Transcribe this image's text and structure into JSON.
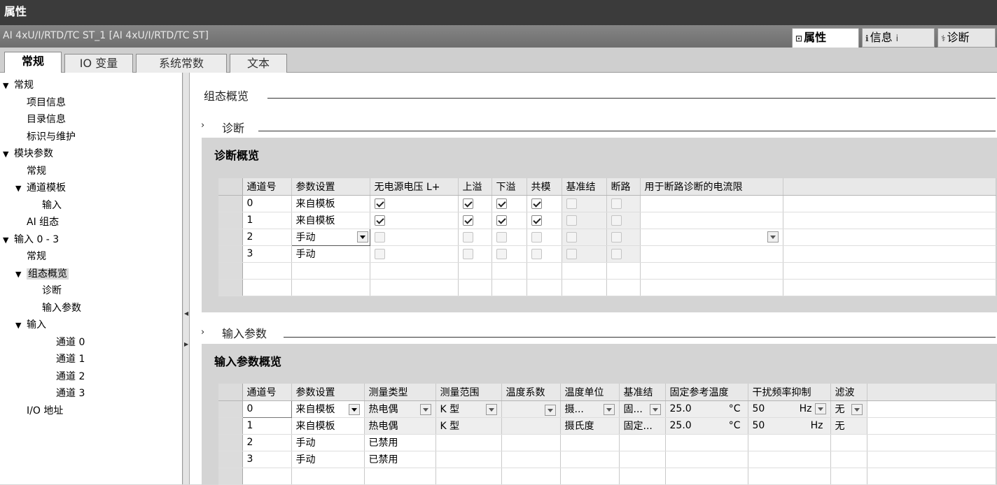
{
  "window": {
    "title": "属性"
  },
  "objectbar": {
    "text": "AI 4xU/I/RTD/TC ST_1 [AI 4xU/I/RTD/TC ST]"
  },
  "right_tabs": [
    {
      "label": "属性",
      "icon": "properties-icon"
    },
    {
      "label": "信息",
      "icon": "info-icon"
    },
    {
      "label": "诊断",
      "icon": "diagnostics-icon"
    }
  ],
  "tabs": [
    {
      "label": "常规"
    },
    {
      "label": "IO 变量"
    },
    {
      "label": "系统常数"
    },
    {
      "label": "文本"
    }
  ],
  "tree": [
    {
      "label": "常规",
      "level": 0,
      "expanded": true
    },
    {
      "label": "项目信息",
      "level": 1
    },
    {
      "label": "目录信息",
      "level": 1
    },
    {
      "label": "标识与维护",
      "level": 1
    },
    {
      "label": "模块参数",
      "level": 0,
      "expanded": true
    },
    {
      "label": "常规",
      "level": 1
    },
    {
      "label": "通道模板",
      "level": 1,
      "expanded": true
    },
    {
      "label": "输入",
      "level": 2
    },
    {
      "label": "AI 组态",
      "level": 1
    },
    {
      "label": "输入 0 - 3",
      "level": 0,
      "expanded": true
    },
    {
      "label": "常规",
      "level": 1
    },
    {
      "label": "组态概览",
      "level": 1,
      "expanded": true,
      "selected": true
    },
    {
      "label": "诊断",
      "level": 2
    },
    {
      "label": "输入参数",
      "level": 2
    },
    {
      "label": "输入",
      "level": 1,
      "expanded": true
    },
    {
      "label": "通道 0",
      "level": 3
    },
    {
      "label": "通道 1",
      "level": 3
    },
    {
      "label": "通道 2",
      "level": 3
    },
    {
      "label": "通道 3",
      "level": 3
    },
    {
      "label": "I/O 地址",
      "level": 1
    }
  ],
  "main": {
    "section_title": "组态概览",
    "diag": {
      "section": "诊断",
      "title": "诊断概览",
      "headers": [
        "通道号",
        "参数设置",
        "无电源电压 L+",
        "上溢",
        "下溢",
        "共模",
        "基准结",
        "断路",
        "用于断路诊断的电流限"
      ],
      "rows": [
        {
          "ch": "0",
          "param": "来自模板",
          "checks": [
            true,
            true,
            true,
            true,
            false,
            false
          ]
        },
        {
          "ch": "1",
          "param": "来自模板",
          "checks": [
            true,
            true,
            true,
            true,
            false,
            false
          ]
        },
        {
          "ch": "2",
          "param": "手动",
          "checks": [
            false,
            false,
            false,
            false,
            false,
            false
          ]
        },
        {
          "ch": "3",
          "param": "手动",
          "checks": [
            false,
            false,
            false,
            false,
            false,
            false
          ]
        }
      ]
    },
    "input": {
      "section": "输入参数",
      "title": "输入参数概览",
      "headers": [
        "通道号",
        "参数设置",
        "测量类型",
        "测量范围",
        "温度系数",
        "温度单位",
        "基准结",
        "固定参考温度",
        "干扰频率抑制",
        "滤波"
      ],
      "rows": [
        {
          "ch": "0",
          "param": "来自模板",
          "type": "热电偶",
          "range": "K 型",
          "coef": "",
          "unit": "摄...",
          "ref": "固...",
          "temp": "25.0",
          "temp_unit": "°C",
          "freq": "50",
          "freq_unit": "Hz",
          "filter": "无"
        },
        {
          "ch": "1",
          "param": "来自模板",
          "type": "热电偶",
          "range": "K 型",
          "coef": "",
          "unit": "摄氏度",
          "ref": "固定...",
          "temp": "25.0",
          "temp_unit": "°C",
          "freq": "50",
          "freq_unit": "Hz",
          "filter": "无"
        },
        {
          "ch": "2",
          "param": "手动",
          "type": "已禁用",
          "range": "",
          "coef": "",
          "unit": "",
          "ref": "",
          "temp": "",
          "temp_unit": "",
          "freq": "",
          "freq_unit": "",
          "filter": ""
        },
        {
          "ch": "3",
          "param": "手动",
          "type": "已禁用",
          "range": "",
          "coef": "",
          "unit": "",
          "ref": "",
          "temp": "",
          "temp_unit": "",
          "freq": "",
          "freq_unit": "",
          "filter": ""
        }
      ]
    }
  }
}
